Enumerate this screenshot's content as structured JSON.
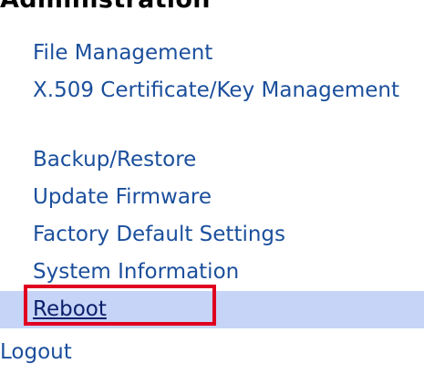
{
  "section": {
    "title": "Administration"
  },
  "nav": {
    "items": [
      {
        "label": "File Management"
      },
      {
        "label": "X.509 Certificate/Key Management"
      },
      {
        "label": "Backup/Restore"
      },
      {
        "label": "Update Firmware"
      },
      {
        "label": "Factory Default Settings"
      },
      {
        "label": "System Information"
      },
      {
        "label": "Reboot",
        "selected": true
      }
    ]
  },
  "logout": {
    "label": "Logout"
  },
  "colors": {
    "link": "#1b4f9c",
    "selected_background": "#c6d4f7",
    "highlight_border": "#e00020"
  }
}
